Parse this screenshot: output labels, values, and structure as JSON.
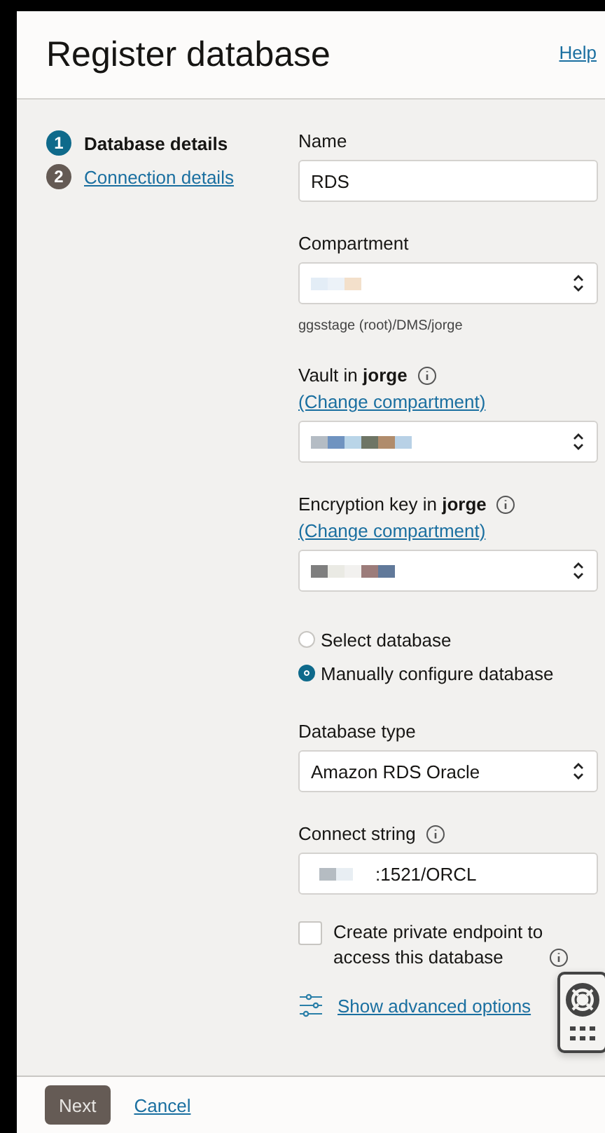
{
  "header": {
    "title": "Register database",
    "help_link": "Help"
  },
  "steps": [
    {
      "number": "1",
      "label": "Database details",
      "selected": true
    },
    {
      "number": "2",
      "label": "Connection details",
      "selected": false
    }
  ],
  "form": {
    "name": {
      "label": "Name",
      "value": "RDS"
    },
    "compartment": {
      "label": "Compartment",
      "helper": "ggsstage (root)/DMS/jorge"
    },
    "vault": {
      "label": "Vault in **jorge**",
      "link": "(Change compartment)"
    },
    "encryption_key": {
      "label": "Encryption key in **jorge**",
      "link": "(Change compartment)"
    },
    "mode_options": [
      {
        "label": "Select database",
        "selected": false
      },
      {
        "label": "Manually configure database",
        "selected": true
      }
    ],
    "database_type": {
      "label": "Database type",
      "value": "Amazon RDS Oracle"
    },
    "connect_string": {
      "label": "Connect string",
      "value": ":1521/ORCL"
    },
    "private_endpoint": {
      "label": "Create private endpoint to access this database",
      "checked": false
    },
    "advanced_link": "Show advanced options"
  },
  "footer": {
    "primary": "Next",
    "secondary": "Cancel"
  }
}
